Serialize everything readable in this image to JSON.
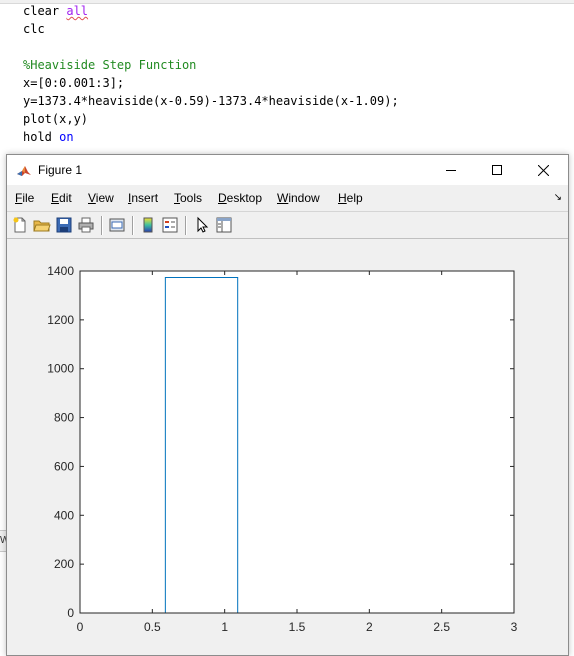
{
  "editor": {
    "lines": [
      {
        "a": "clear ",
        "b": "all"
      },
      {
        "a": "clc"
      },
      {
        "a": ""
      },
      {
        "c": "%Heaviside Step Function"
      },
      {
        "a": "x=[0:0.001:3];"
      },
      {
        "a": "y=1373.4*heaviside(x-0.59)-1373.4*heaviside(x-1.09);"
      },
      {
        "a": "plot(x,y)"
      },
      {
        "a": "hold ",
        "k": "on"
      }
    ]
  },
  "figure": {
    "title": "Figure 1",
    "menu": [
      "File",
      "Edit",
      "View",
      "Insert",
      "Tools",
      "Desktop",
      "Window",
      "Help"
    ],
    "menu_underline": [
      "F",
      "E",
      "V",
      "I",
      "T",
      "D",
      "W",
      "H"
    ],
    "colors": {
      "line": "#0072bd",
      "axes_bg": "#ffffff",
      "figure_bg": "#f0f0f0"
    }
  },
  "chart_data": {
    "type": "line",
    "title": "",
    "xlabel": "",
    "ylabel": "",
    "xlim": [
      0,
      3
    ],
    "ylim": [
      0,
      1400
    ],
    "xticks": [
      0,
      0.5,
      1,
      1.5,
      2,
      2.5,
      3
    ],
    "xtick_labels": [
      "0",
      "0.5",
      "1",
      "1.5",
      "2",
      "2.5",
      "3"
    ],
    "yticks": [
      0,
      200,
      400,
      600,
      800,
      1000,
      1200,
      1400
    ],
    "ytick_labels": [
      "0",
      "200",
      "400",
      "600",
      "800",
      "1000",
      "1200",
      "1400"
    ],
    "grid": false,
    "series": [
      {
        "x": [
          0,
          0.59,
          0.59,
          1.09,
          1.09,
          3
        ],
        "y": [
          0,
          0,
          1373.4,
          1373.4,
          0,
          0
        ]
      }
    ]
  }
}
